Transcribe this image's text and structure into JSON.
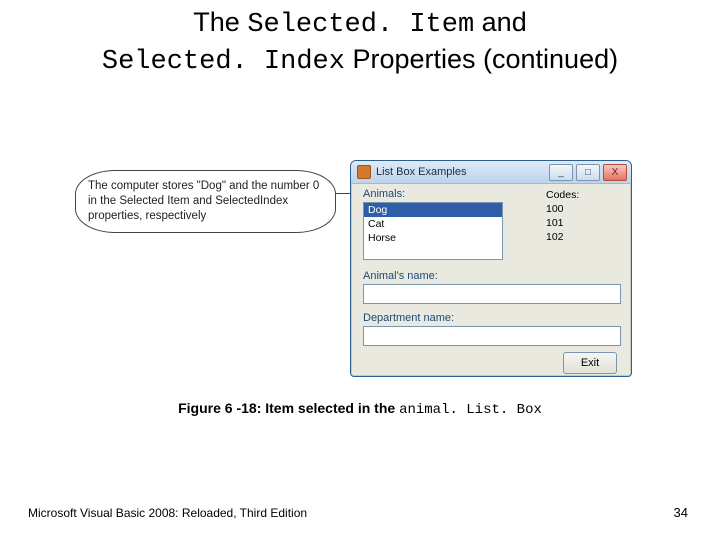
{
  "title": {
    "pre": "The ",
    "code1": "Selected. Item",
    "mid": " and ",
    "code2": "Selected. Index",
    "post": " Properties (continued)"
  },
  "callout": "The computer stores \"Dog\" and the number 0 in the Selected Item and SelectedIndex properties, respectively",
  "window": {
    "title": "List Box Examples",
    "labels": {
      "animals": "Animals:",
      "codes": "Codes:",
      "aname": "Animal's name:",
      "dname": "Department name:"
    },
    "list": [
      "Dog",
      "Cat",
      "Horse"
    ],
    "codes": [
      "100",
      "101",
      "102"
    ],
    "exit": "Exit"
  },
  "caption": {
    "lead": "Figure 6 -18: Item selected in the ",
    "code": "animal. List. Box"
  },
  "footer": "Microsoft Visual Basic 2008: Reloaded, Third Edition",
  "page": "34"
}
